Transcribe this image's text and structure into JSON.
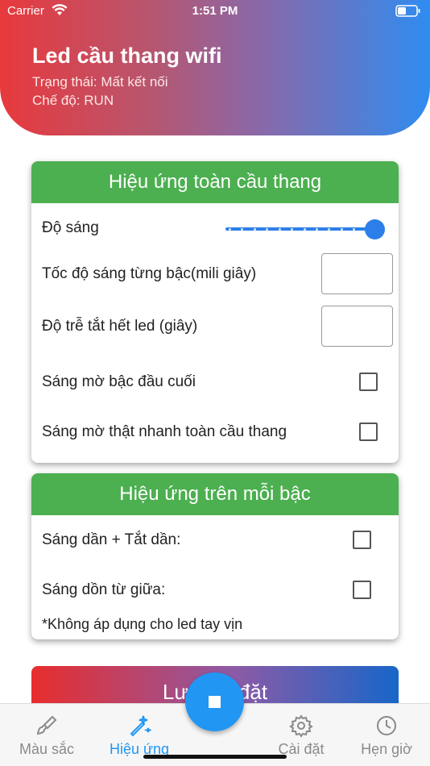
{
  "status_bar": {
    "carrier": "Carrier",
    "time": "1:51 PM"
  },
  "header": {
    "title": "Led cầu thang wifi",
    "status": "Trạng thái: Mất kết nối",
    "mode": "Chế độ: RUN"
  },
  "card_global": {
    "title": "Hiệu ứng toàn cầu thang",
    "brightness_label": "Độ sáng",
    "brightness_value": 1.0,
    "step_speed_label": "Tốc độ sáng từng bậc(mili giây)",
    "step_speed_value": "",
    "off_delay_label": "Độ trễ tắt hết led (giây)",
    "off_delay_value": "",
    "dim_ends_label": "Sáng mờ bậc đầu cuối",
    "dim_ends_checked": false,
    "fast_dim_label": "Sáng mờ thật nhanh toàn cầu thang",
    "fast_dim_checked": false
  },
  "card_step": {
    "title": "Hiệu ứng trên mỗi bậc",
    "fade_label": "Sáng dần + Tắt dần:",
    "fade_checked": false,
    "center_label": "Sáng dồn từ giữa:",
    "center_checked": false,
    "note": "*Không áp dụng cho led tay vịn"
  },
  "save_button": {
    "label": "Lưu cài đặt"
  },
  "bottom_nav": {
    "items": [
      {
        "label": "Màu sắc",
        "icon": "brush-icon",
        "active": false
      },
      {
        "label": "Hiệu ứng",
        "icon": "magic-wand-icon",
        "active": true
      },
      {
        "label": "Cài đặt",
        "icon": "gear-icon",
        "active": false
      },
      {
        "label": "Hẹn giờ",
        "icon": "clock-icon",
        "active": false
      }
    ],
    "fab_icon": "stop-icon"
  },
  "colors": {
    "accent": "#2196f3",
    "card_header": "#4caf50",
    "header_gradient_start": "#e8393c",
    "header_gradient_end": "#2f8cf0"
  }
}
